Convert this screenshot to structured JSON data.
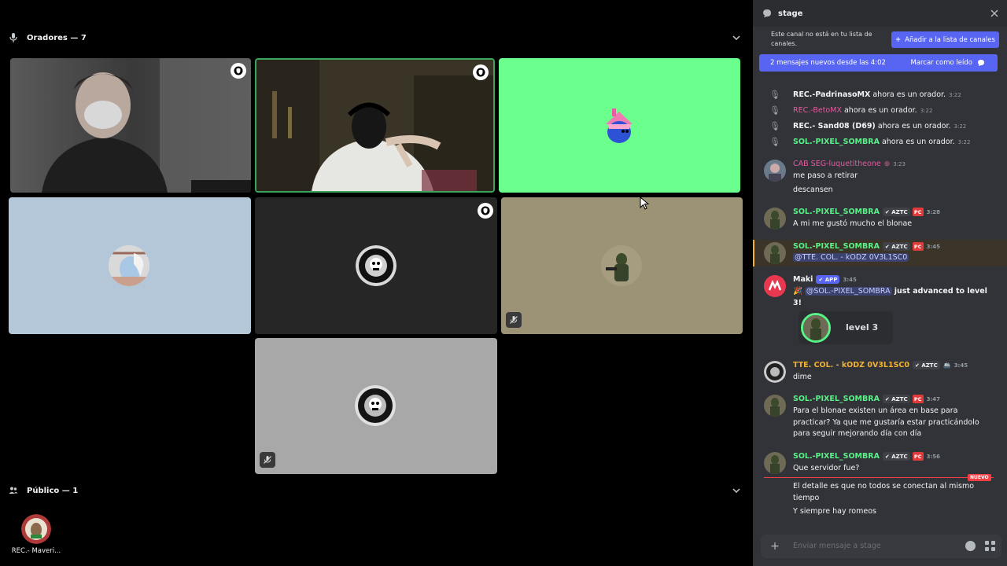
{
  "stage": {
    "speakers_header": "Oradores — 7",
    "audience_header": "Público — 1",
    "audience_member_name": "REC.- Maveri...",
    "colors": {
      "speaking_border": "#3ba55d",
      "green_tile": "#6bff8e",
      "blue_tile": "#b4c7d9",
      "tan_tile": "#9c9275",
      "gray_tile": "#a8a8a8"
    }
  },
  "panel": {
    "channel_name": "stage",
    "notice_text": "Este canal no está en tu lista de canales.",
    "add_button_label": "Añadir a la lista de canales",
    "new_messages_text": "2 mensajes nuevos desde las 4:02",
    "mark_read_label": "Marcar como leído",
    "new_divider_label": "NUEVO",
    "composer_placeholder": "Enviar mensaje a stage"
  },
  "system_messages": [
    {
      "name": "REC.-PadrinasoMX",
      "text": "ahora es un orador.",
      "time": "3:22",
      "color": "#f2f3f5"
    },
    {
      "name": "REC.-BetoMX",
      "text": "ahora es un orador.",
      "time": "3:22",
      "color": "#e35b9e"
    },
    {
      "name": "REC.- Sand08 (D69)",
      "text": "ahora es un orador.",
      "time": "3:22",
      "color": "#f2f3f5"
    },
    {
      "name": "SOL.-PIXEL_SOMBRA",
      "text": "ahora es un orador.",
      "time": "3:22",
      "color": "#58f287"
    }
  ],
  "messages": [
    {
      "name": "CAB SEG-luquetitheone",
      "name_color": "#e35b9e",
      "time": "3:23",
      "lines": [
        "me paso a retirar",
        "descansen"
      ]
    },
    {
      "name": "SOL.-PIXEL_SOMBRA",
      "name_color": "#58f287",
      "tag": "AZTC",
      "pc": "PC",
      "time": "3:28",
      "lines": [
        "A mi me gustó mucho el blonae"
      ]
    },
    {
      "name": "SOL.-PIXEL_SOMBRA",
      "name_color": "#58f287",
      "tag": "AZTC",
      "pc": "PC",
      "time": "3:45",
      "mention": "@TTE. COL. - kODZ 0V3L1SC0"
    },
    {
      "name": "Maki",
      "name_color": "#f2f3f5",
      "app_tag": "APP",
      "time": "3:45",
      "mention": "@SOL.-PIXEL_SOMBRA",
      "text_bold": "just advanced to level",
      "text_bold_2": "3!",
      "level_card": "level 3"
    },
    {
      "name": "TTE. COL. - kODZ 0V3L1SC0",
      "name_color": "#f0b232",
      "tag": "AZTC",
      "time": "3:45",
      "lines": [
        "dime"
      ]
    },
    {
      "name": "SOL.-PIXEL_SOMBRA",
      "name_color": "#58f287",
      "tag": "AZTC",
      "pc": "PC",
      "time": "3:47",
      "lines": [
        "Para el blonae existen un área en base para",
        "practicar? Ya que me gustaría estar practicándolo",
        "para seguir mejorando día con día"
      ]
    },
    {
      "name": "SOL.-PIXEL_SOMBRA",
      "name_color": "#58f287",
      "tag": "AZTC",
      "pc": "PC",
      "time": "3:56",
      "lines": [
        "Que servidor fue?"
      ],
      "after_divider": [
        "El detalle es que no todos se conectan al mismo",
        "tiempo",
        "Y siempre hay romeos"
      ]
    }
  ]
}
